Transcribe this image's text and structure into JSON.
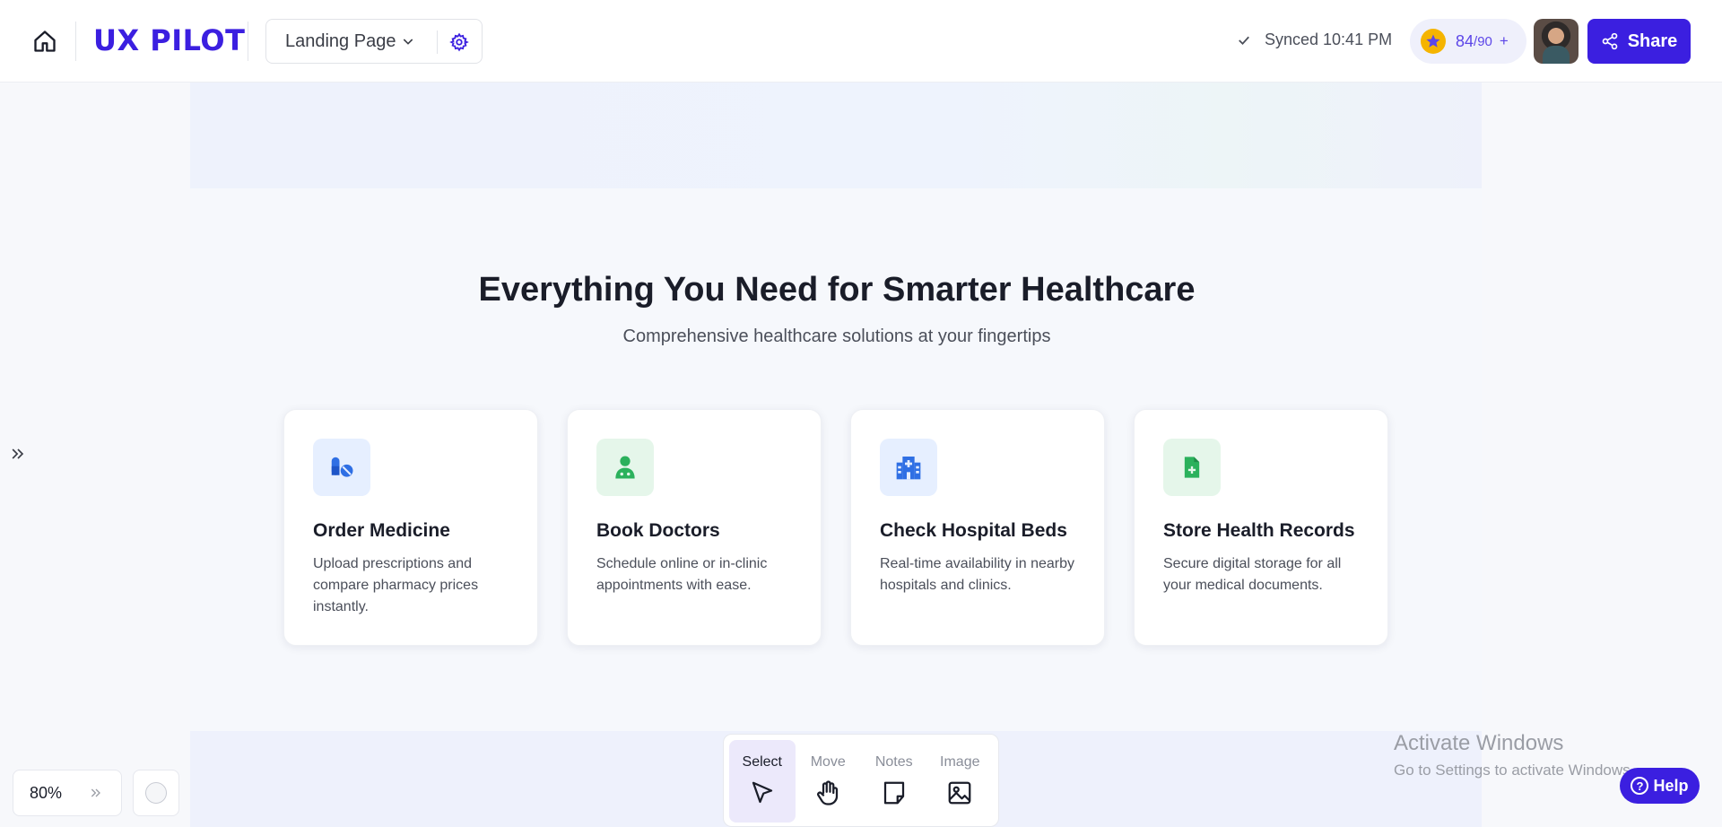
{
  "header": {
    "logo": "UX PILOT",
    "page_name": "Landing Page",
    "sync_status": "Synced 10:41 PM",
    "credits_used": "84",
    "credits_total": "/90",
    "credits_plus": "+",
    "share_label": "Share",
    "accent_color": "#3b1fe0"
  },
  "section": {
    "title": "Everything You Need for Smarter Healthcare",
    "subtitle": "Comprehensive healthcare solutions at your fingertips",
    "cards": [
      {
        "title": "Order Medicine",
        "description": "Upload prescriptions and compare pharmacy prices instantly.",
        "icon": "pills-icon",
        "icon_color": "#2f6fe4",
        "icon_bg": "#e6efff"
      },
      {
        "title": "Book Doctors",
        "description": "Schedule online or in-clinic appointments with ease.",
        "icon": "doctor-icon",
        "icon_color": "#2bb15c",
        "icon_bg": "#e5f6ea"
      },
      {
        "title": "Check Hospital Beds",
        "description": "Real-time availability in nearby hospitals and clinics.",
        "icon": "hospital-icon",
        "icon_color": "#2f6fe4",
        "icon_bg": "#e6efff"
      },
      {
        "title": "Store Health Records",
        "description": "Secure digital storage for all your medical documents.",
        "icon": "file-medical-icon",
        "icon_color": "#2bb15c",
        "icon_bg": "#e5f6ea"
      }
    ]
  },
  "toolbar": {
    "tools": [
      {
        "label": "Select",
        "icon": "cursor-icon",
        "active": true
      },
      {
        "label": "Move",
        "icon": "hand-icon",
        "active": false
      },
      {
        "label": "Notes",
        "icon": "note-icon",
        "active": false
      },
      {
        "label": "Image",
        "icon": "image-icon",
        "active": false
      }
    ]
  },
  "zoom": {
    "level": "80%"
  },
  "windows_notice": {
    "title": "Activate Windows",
    "subtitle": "Go to Settings to activate Windows."
  },
  "help": {
    "label": "Help"
  }
}
